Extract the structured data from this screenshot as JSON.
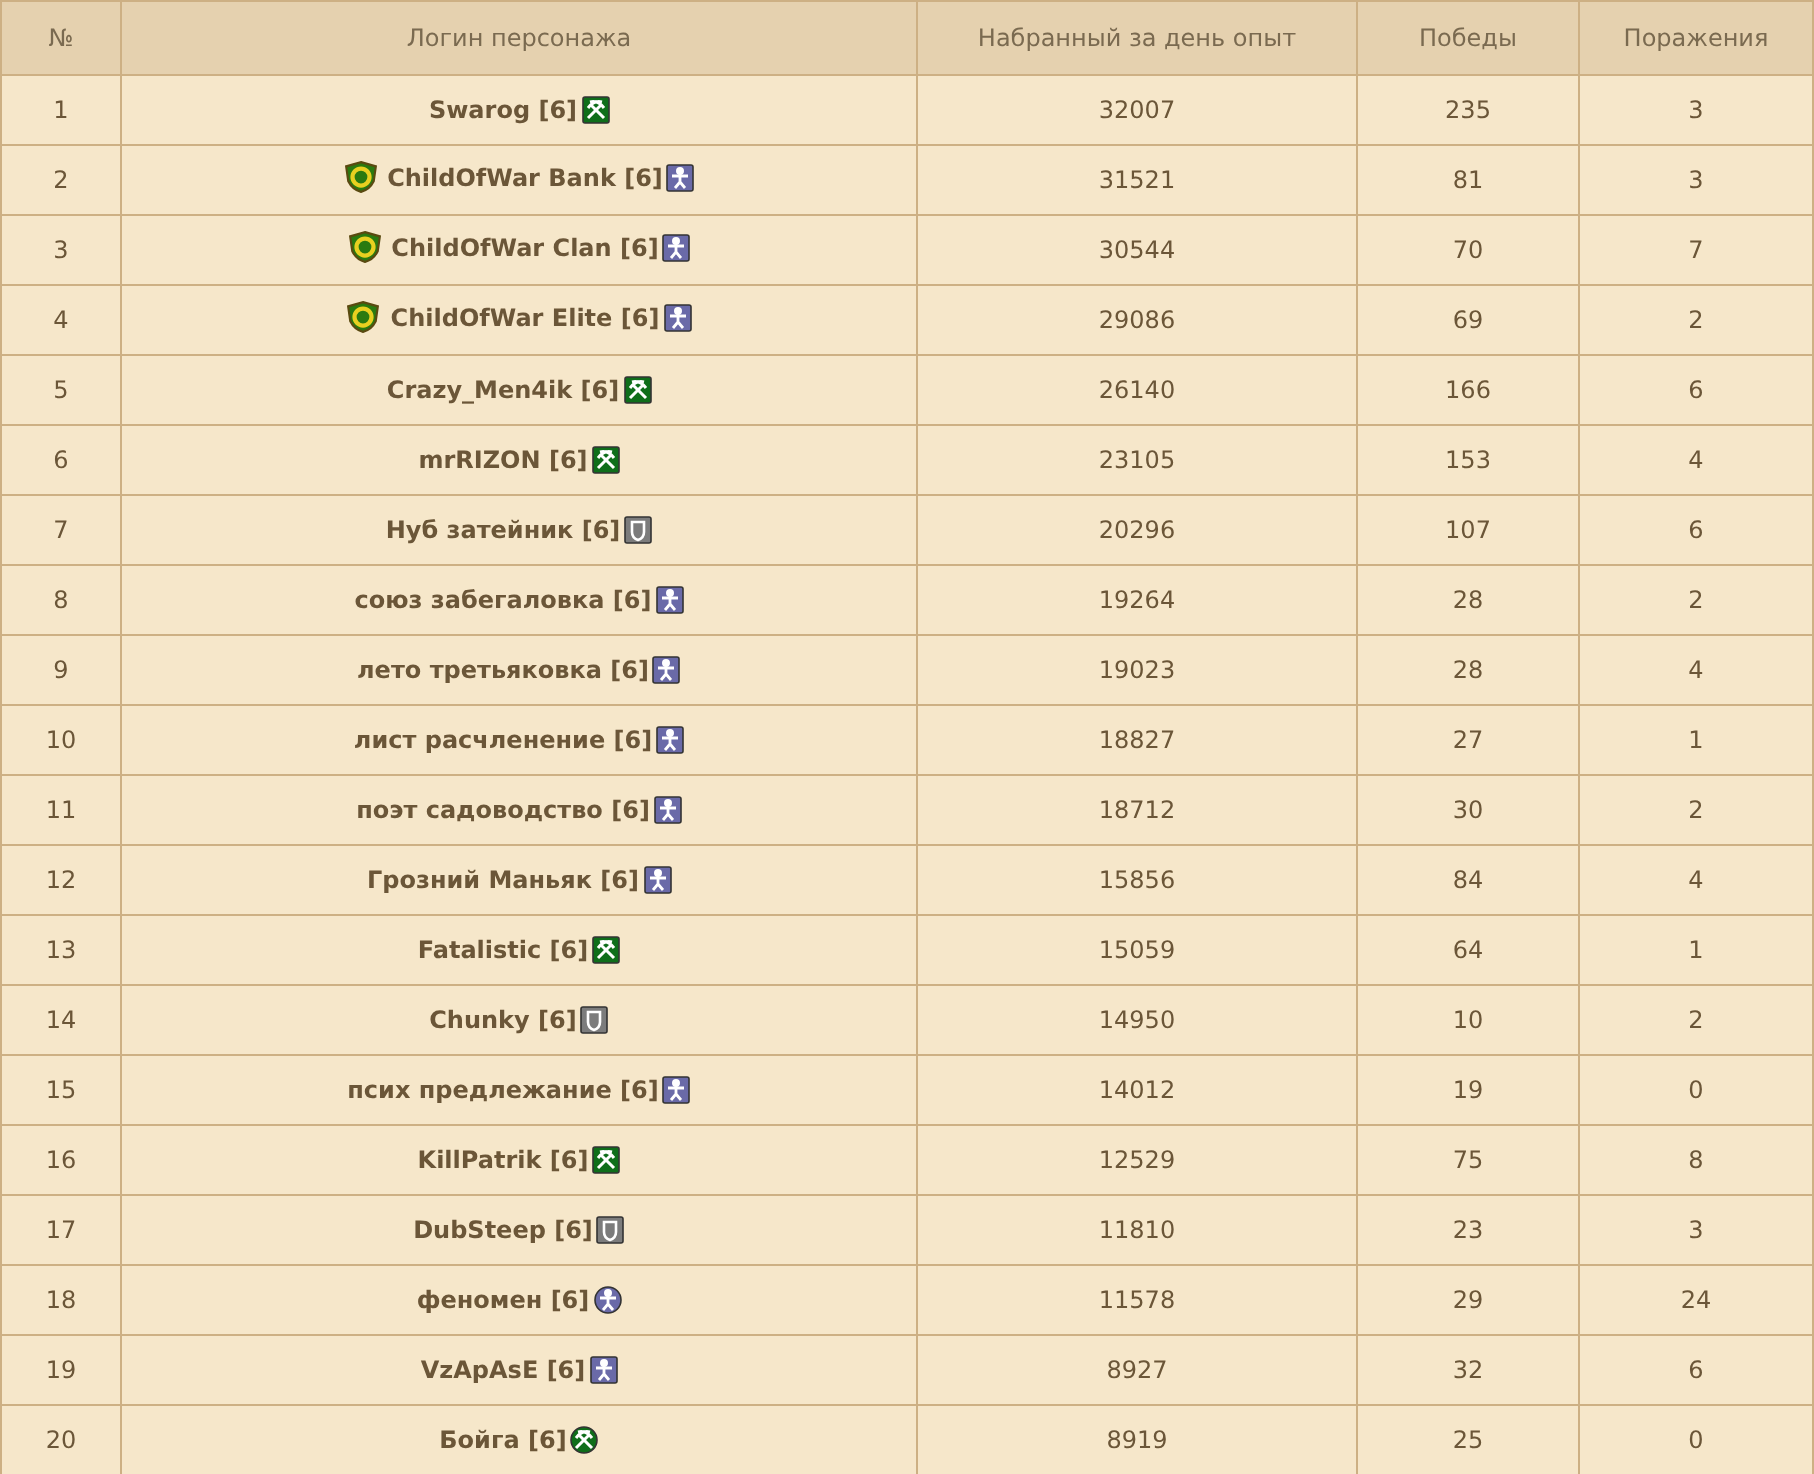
{
  "columns": [
    "№",
    "Логин персонажа",
    "Набранный за день опыт",
    "Победы",
    "Поражения"
  ],
  "rows": [
    {
      "rank": "1",
      "login": "Swarog [6]",
      "clan": false,
      "kind": "miner",
      "round": false,
      "exp": "32007",
      "wins": "235",
      "losses": "3"
    },
    {
      "rank": "2",
      "login": "ChildOfWar Bank [6]",
      "clan": true,
      "kind": "warrior",
      "round": false,
      "exp": "31521",
      "wins": "81",
      "losses": "3"
    },
    {
      "rank": "3",
      "login": "ChildOfWar Clan [6]",
      "clan": true,
      "kind": "warrior",
      "round": false,
      "exp": "30544",
      "wins": "70",
      "losses": "7"
    },
    {
      "rank": "4",
      "login": "ChildOfWar Elite [6]",
      "clan": true,
      "kind": "warrior",
      "round": false,
      "exp": "29086",
      "wins": "69",
      "losses": "2"
    },
    {
      "rank": "5",
      "login": "Crazy_Men4ik [6]",
      "clan": false,
      "kind": "miner",
      "round": false,
      "exp": "26140",
      "wins": "166",
      "losses": "6"
    },
    {
      "rank": "6",
      "login": "mrRIZON [6]",
      "clan": false,
      "kind": "miner",
      "round": false,
      "exp": "23105",
      "wins": "153",
      "losses": "4"
    },
    {
      "rank": "7",
      "login": "Нуб затейник [6]",
      "clan": false,
      "kind": "guard",
      "round": false,
      "exp": "20296",
      "wins": "107",
      "losses": "6"
    },
    {
      "rank": "8",
      "login": "союз забегаловка [6]",
      "clan": false,
      "kind": "warrior",
      "round": false,
      "exp": "19264",
      "wins": "28",
      "losses": "2"
    },
    {
      "rank": "9",
      "login": "лето третьяковка [6]",
      "clan": false,
      "kind": "warrior",
      "round": false,
      "exp": "19023",
      "wins": "28",
      "losses": "4"
    },
    {
      "rank": "10",
      "login": "лист расчленение [6]",
      "clan": false,
      "kind": "warrior",
      "round": false,
      "exp": "18827",
      "wins": "27",
      "losses": "1"
    },
    {
      "rank": "11",
      "login": "поэт садоводство [6]",
      "clan": false,
      "kind": "warrior",
      "round": false,
      "exp": "18712",
      "wins": "30",
      "losses": "2"
    },
    {
      "rank": "12",
      "login": "Грозний Маньяк [6]",
      "clan": false,
      "kind": "warrior",
      "round": false,
      "exp": "15856",
      "wins": "84",
      "losses": "4"
    },
    {
      "rank": "13",
      "login": "Fatalistic [6]",
      "clan": false,
      "kind": "miner",
      "round": false,
      "exp": "15059",
      "wins": "64",
      "losses": "1"
    },
    {
      "rank": "14",
      "login": "Chunky [6]",
      "clan": false,
      "kind": "guard",
      "round": false,
      "exp": "14950",
      "wins": "10",
      "losses": "2"
    },
    {
      "rank": "15",
      "login": "псих предлежание [6]",
      "clan": false,
      "kind": "warrior",
      "round": false,
      "exp": "14012",
      "wins": "19",
      "losses": "0"
    },
    {
      "rank": "16",
      "login": "KillPatrik [6]",
      "clan": false,
      "kind": "miner",
      "round": false,
      "exp": "12529",
      "wins": "75",
      "losses": "8"
    },
    {
      "rank": "17",
      "login": "DubSteep [6]",
      "clan": false,
      "kind": "guard",
      "round": false,
      "exp": "11810",
      "wins": "23",
      "losses": "3"
    },
    {
      "rank": "18",
      "login": "феномен [6]",
      "clan": false,
      "kind": "warrior",
      "round": true,
      "exp": "11578",
      "wins": "29",
      "losses": "24"
    },
    {
      "rank": "19",
      "login": "VzApAsE [6]",
      "clan": false,
      "kind": "warrior",
      "round": false,
      "exp": "8927",
      "wins": "32",
      "losses": "6"
    },
    {
      "rank": "20",
      "login": "Бойга [6]",
      "clan": false,
      "kind": "miner",
      "round": true,
      "exp": "8919",
      "wins": "25",
      "losses": "0"
    }
  ]
}
